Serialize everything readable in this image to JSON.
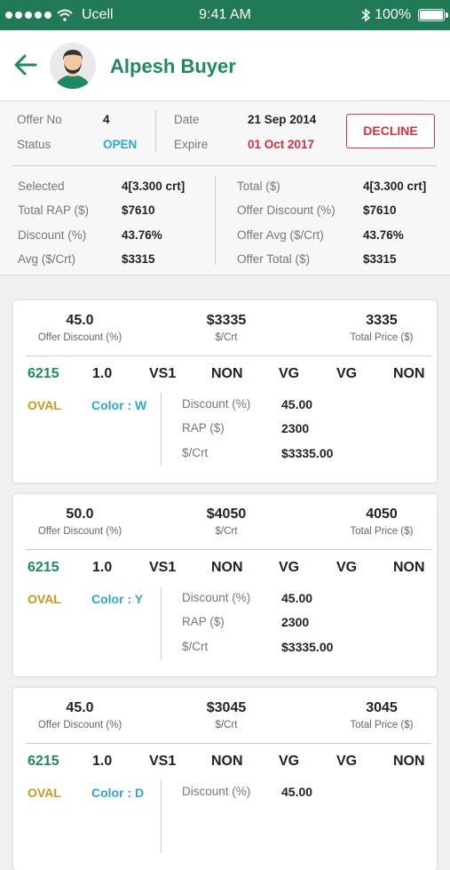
{
  "status_bar": {
    "carrier": "Ucell",
    "time": "9:41 AM",
    "battery": "100%"
  },
  "header": {
    "title": "Alpesh Buyer"
  },
  "offer": {
    "offer_no_label": "Offer No",
    "offer_no": "4",
    "status_label": "Status",
    "status": "OPEN",
    "date_label": "Date",
    "date": "21 Sep 2014",
    "expire_label": "Expire",
    "expire": "01 Oct 2017",
    "decline_label": "DECLINE"
  },
  "totals": {
    "left": [
      {
        "label": "Selected",
        "value": "4[3.300 crt]"
      },
      {
        "label": "Total RAP ($)",
        "value": "$7610"
      },
      {
        "label": "Discount (%)",
        "value": "43.76%"
      },
      {
        "label": "Avg ($/Crt)",
        "value": "$3315"
      }
    ],
    "right": [
      {
        "label": "Total ($)",
        "value": "4[3.300 crt]"
      },
      {
        "label": "Offer Discount (%)",
        "value": "$7610"
      },
      {
        "label": "Offer Avg ($/Crt)",
        "value": "43.76%"
      },
      {
        "label": "Offer Total ($)",
        "value": "$3315"
      }
    ]
  },
  "items": [
    {
      "offer_discount": "45.0",
      "offer_discount_label": "Offer Discount (%)",
      "per_crt": "$3335",
      "per_crt_label": "$/Crt",
      "total_price": "3335",
      "total_price_label": "Total Price ($)",
      "id": "6215",
      "carat": "1.0",
      "clarity": "VS1",
      "s1": "NON",
      "s2": "VG",
      "s3": "VG",
      "s4": "NON",
      "shape": "OVAL",
      "color": "Color : W",
      "discount_label": "Discount (%)",
      "discount": "45.00",
      "rap_label": "RAP ($)",
      "rap": "2300",
      "crt_label": "$/Crt",
      "crt": "$3335.00"
    },
    {
      "offer_discount": "50.0",
      "offer_discount_label": "Offer Discount (%)",
      "per_crt": "$4050",
      "per_crt_label": "$/Crt",
      "total_price": "4050",
      "total_price_label": "Total Price ($)",
      "id": "6215",
      "carat": "1.0",
      "clarity": "VS1",
      "s1": "NON",
      "s2": "VG",
      "s3": "VG",
      "s4": "NON",
      "shape": "OVAL",
      "color": "Color : Y",
      "discount_label": "Discount (%)",
      "discount": "45.00",
      "rap_label": "RAP ($)",
      "rap": "2300",
      "crt_label": "$/Crt",
      "crt": "$3335.00"
    },
    {
      "offer_discount": "45.0",
      "offer_discount_label": "Offer Discount (%)",
      "per_crt": "$3045",
      "per_crt_label": "$/Crt",
      "total_price": "3045",
      "total_price_label": "Total Price ($)",
      "id": "6215",
      "carat": "1.0",
      "clarity": "VS1",
      "s1": "NON",
      "s2": "VG",
      "s3": "VG",
      "s4": "NON",
      "shape": "OVAL",
      "color": "Color : D",
      "discount_label": "Discount (%)",
      "discount": "45.00"
    }
  ]
}
